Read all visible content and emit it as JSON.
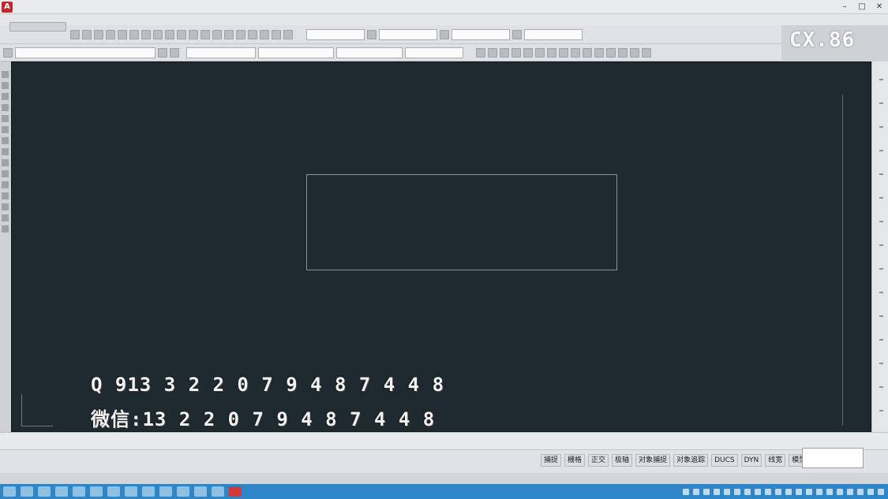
{
  "titlebar": {
    "app_icon": "A",
    "title": "",
    "min_icon": "minimize-icon",
    "max_icon": "maximize-icon",
    "close_icon": "close-icon",
    "min_glyph": "–",
    "max_glyph": "□",
    "close_glyph": "✕"
  },
  "menu": {
    "items": [
      "",
      "",
      "",
      "",
      "",
      "",
      "",
      "",
      "",
      "",
      "",
      "",
      ""
    ]
  },
  "toolbar": {
    "drawing_tab": "",
    "fields_row1": [
      "",
      "",
      "",
      ""
    ],
    "fields_row2": [
      "",
      "",
      "",
      "",
      ""
    ]
  },
  "logo": {
    "text": "CX.86"
  },
  "canvas": {
    "label": "",
    "ucs_label": ""
  },
  "watermark": {
    "line1": "Q 913 3 2 2 0 7 9 4 8 7 4 4 8",
    "line2": "微信:13 2 2 0 7 9 4 8 7 4 4 8"
  },
  "command": {
    "line1": "",
    "line2": ""
  },
  "status": {
    "buttons": [
      "捕捉",
      "栅格",
      "正交",
      "极轴",
      "对象捕捉",
      "对象追踪",
      "DUCS",
      "DYN",
      "线宽",
      "模型"
    ],
    "box_text": "",
    "coords": ""
  },
  "colors": {
    "canvas_bg": "#1f2a30",
    "shape_stroke": "#8a939a",
    "taskbar": "#2e86c6"
  }
}
